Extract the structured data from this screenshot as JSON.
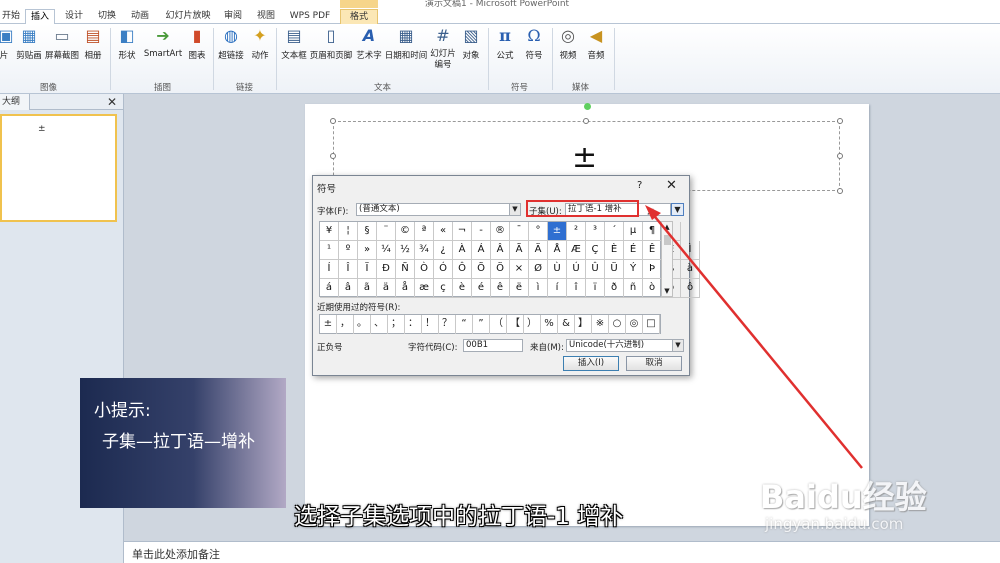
{
  "window": {
    "title": "演示文稿1 - Microsoft PowerPoint",
    "context_tab": "绘图工具"
  },
  "tabs": [
    "开始",
    "插入",
    "设计",
    "切换",
    "动画",
    "幻灯片放映",
    "审阅",
    "视图",
    "WPS PDF",
    "格式"
  ],
  "active_tab": "插入",
  "ribbon": {
    "buttons": [
      {
        "label": "片",
        "icon": "picture-icon"
      },
      {
        "label": "剪贴画",
        "icon": "clipart-icon"
      },
      {
        "label": "屏幕截图",
        "icon": "screenshot-icon"
      },
      {
        "label": "相册",
        "icon": "album-icon"
      },
      {
        "label": "形状",
        "icon": "shapes-icon"
      },
      {
        "label": "SmartArt",
        "icon": "smartart-icon"
      },
      {
        "label": "图表",
        "icon": "chart-icon"
      },
      {
        "label": "超链接",
        "icon": "hyperlink-icon"
      },
      {
        "label": "动作",
        "icon": "action-icon"
      },
      {
        "label": "文本框",
        "icon": "textbox-icon"
      },
      {
        "label": "页眉和页脚",
        "icon": "header-footer-icon"
      },
      {
        "label": "艺术字",
        "icon": "wordart-icon"
      },
      {
        "label": "日期和时间",
        "icon": "datetime-icon"
      },
      {
        "label": "幻灯片编号",
        "icon": "slide-number-icon"
      },
      {
        "label": "对象",
        "icon": "object-icon"
      },
      {
        "label": "公式",
        "icon": "equation-icon"
      },
      {
        "label": "符号",
        "icon": "symbol-icon"
      },
      {
        "label": "视频",
        "icon": "video-icon"
      },
      {
        "label": "音频",
        "icon": "audio-icon"
      }
    ],
    "groups": [
      "图像",
      "插图",
      "链接",
      "文本",
      "符号",
      "媒体"
    ]
  },
  "left_panel": {
    "tab_label": "大纲",
    "close": "✕",
    "thumb_text": "±"
  },
  "slide": {
    "symbol_text": "±"
  },
  "notes": {
    "placeholder": "单击此处添加备注"
  },
  "dialog": {
    "title": "符号",
    "help": "?",
    "close": "✕",
    "font_label": "字体(F):",
    "font_value": "(普通文本)",
    "subset_label": "子集(U):",
    "subset_value": "拉丁语-1 增补",
    "grid": [
      [
        "¥",
        "¦",
        "§",
        "¨",
        "©",
        "ª",
        "«",
        "¬",
        "-",
        "®",
        "¯",
        "°",
        "±",
        "²",
        "³",
        "´",
        "µ",
        "¶",
        "·"
      ],
      [
        "¹",
        "º",
        "»",
        "¼",
        "½",
        "¾",
        "¿",
        "À",
        "Á",
        "Â",
        "Ã",
        "Ä",
        "Å",
        "Æ",
        "Ç",
        "È",
        "É",
        "Ê",
        "Ë",
        "Ì"
      ],
      [
        "Í",
        "Î",
        "Ï",
        "Ð",
        "Ñ",
        "Ò",
        "Ó",
        "Ô",
        "Õ",
        "Ö",
        "×",
        "Ø",
        "Ù",
        "Ú",
        "Û",
        "Ü",
        "Ý",
        "Þ",
        "ß",
        "à"
      ],
      [
        "á",
        "â",
        "ã",
        "ä",
        "å",
        "æ",
        "ç",
        "è",
        "é",
        "ê",
        "ë",
        "ì",
        "í",
        "î",
        "ï",
        "ð",
        "ñ",
        "ò",
        "ó",
        "ô"
      ]
    ],
    "selected_symbol": "±",
    "recent_label": "近期使用过的符号(R):",
    "recent": [
      "±",
      "，",
      "。",
      "、",
      "；",
      "：",
      "！",
      "？",
      "“",
      "”",
      "（",
      "【",
      "）",
      "%",
      "&",
      "】",
      "※",
      "○",
      "◎",
      "□"
    ],
    "char_name": "正负号",
    "char_code_label": "字符代码(C):",
    "char_code_value": "00B1",
    "from_label": "来自(M):",
    "from_value": "Unicode(十六进制)",
    "insert_button": "插入(I)",
    "cancel_button": "取消"
  },
  "tip": {
    "title": "小提示:",
    "body": "子集—拉丁语—增补"
  },
  "caption": "选择子集选项中的拉丁语-1 增补",
  "watermark": {
    "logo": "Baidu经验",
    "url": "jingyan.baidu.com"
  },
  "colors": {
    "accent": "#2f6fd1",
    "annotation": "#e0302f"
  }
}
